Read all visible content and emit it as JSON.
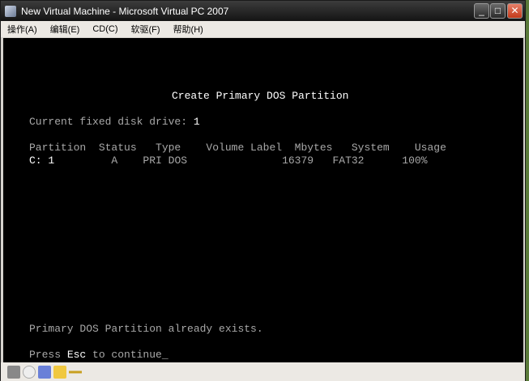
{
  "window": {
    "title": "New Virtual Machine - Microsoft Virtual PC 2007"
  },
  "menu": [
    "操作(A)",
    "编辑(E)",
    "CD(C)",
    "软驱(F)",
    "帮助(H)"
  ],
  "screen": {
    "heading": "Create Primary DOS Partition",
    "drive_label": "Current fixed disk drive: ",
    "drive_value": "1",
    "columns": "Partition  Status   Type    Volume Label  Mbytes   System    Usage",
    "row_part": "C: 1",
    "row_rest": "         A    PRI DOS               16379   FAT32      100%",
    "message": "Primary DOS Partition already exists.",
    "prompt_a": "Press ",
    "prompt_key": "Esc",
    "prompt_b": " to continue",
    "cursor": "_"
  },
  "status_icons": [
    "hard-disk-icon",
    "cd-icon",
    "floppy-icon",
    "shared-folder-icon",
    "network-icon"
  ]
}
